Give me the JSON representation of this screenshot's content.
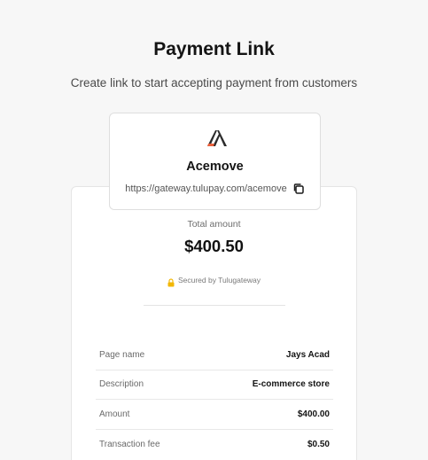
{
  "header": {
    "title": "Payment Link",
    "subtitle": "Create link to start accepting payment from customers"
  },
  "merchant": {
    "logo_icon": "acemove-logo-icon",
    "name": "Acemove",
    "link": "https://gateway.tulupay.com/acemove",
    "copy_icon": "copy-icon"
  },
  "summary": {
    "total_label": "Total amount",
    "total_amount": "$400.50",
    "secured_icon": "lock-icon",
    "secured_text": "Secured by Tulugateway"
  },
  "details": {
    "rows": [
      {
        "label": "Page name",
        "value": "Jays Acad"
      },
      {
        "label": "Description",
        "value": "E-commerce store"
      },
      {
        "label": "Amount",
        "value": "$400.00"
      },
      {
        "label": "Transaction fee",
        "value": "$0.50"
      }
    ]
  },
  "colors": {
    "background": "#f7f7f7",
    "card": "#ffffff",
    "logo_dark": "#2b2b2b",
    "logo_accent": "#e8603c",
    "lock": "#f2b705"
  }
}
